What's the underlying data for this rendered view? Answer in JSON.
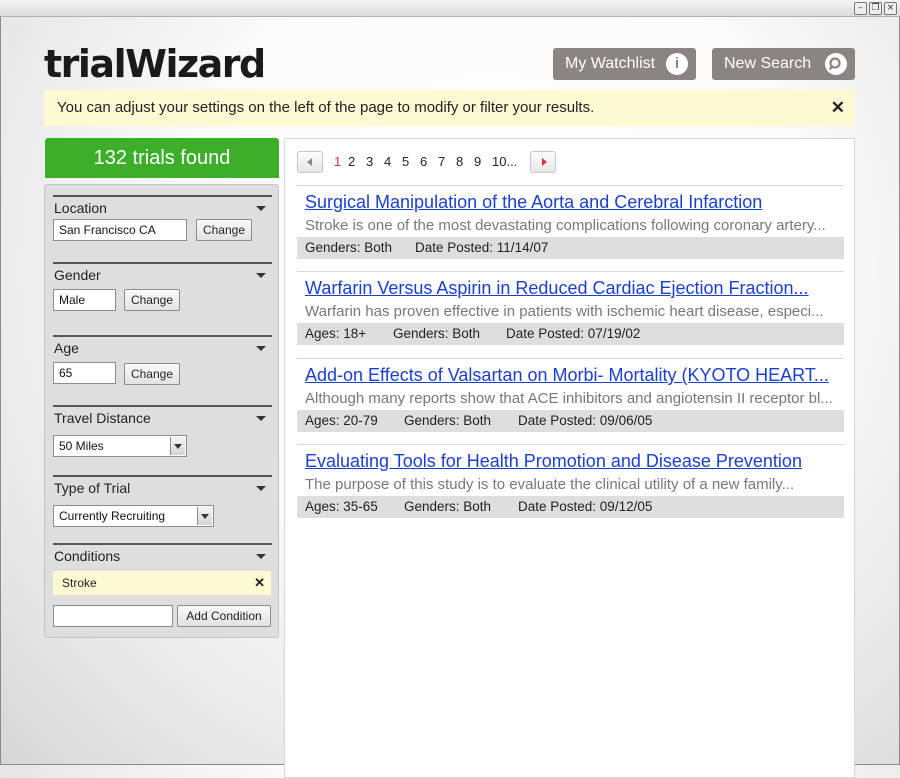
{
  "window": {
    "buttons": [
      "minimize",
      "restore",
      "close"
    ]
  },
  "app": {
    "logo_text": "trialWizard"
  },
  "header": {
    "watchlist_label": "My Watchlist",
    "watchlist_icon": "info-icon",
    "newsearch_label": "New Search",
    "newsearch_icon": "search-icon"
  },
  "notice": {
    "text": "You can adjust your settings on the left of the page to modify or filter your results.",
    "close": "✕"
  },
  "summary": {
    "found": "132 trials found"
  },
  "filters": {
    "location": {
      "label": "Location",
      "value": "San Francisco CA",
      "button": "Change"
    },
    "gender": {
      "label": "Gender",
      "value": "Male",
      "button": "Change"
    },
    "age": {
      "label": "Age",
      "value": "65",
      "button": "Change"
    },
    "distance": {
      "label": "Travel Distance",
      "value": "50 Miles"
    },
    "trial_type": {
      "label": "Type of Trial",
      "value": "Currently Recruiting"
    },
    "conditions": {
      "label": "Conditions",
      "items": [
        {
          "name": "Stroke",
          "remove": "✕"
        }
      ],
      "input_value": "",
      "add_button": "Add Condition"
    }
  },
  "pagination": {
    "current": "1",
    "pages": [
      "1",
      "2",
      "3",
      "4",
      "5",
      "6",
      "7",
      "8",
      "9",
      "10..."
    ]
  },
  "results": [
    {
      "title": "Surgical Manipulation of the Aorta and Cerebral Infarction",
      "desc": "Stroke is one of the most devastating complications following coronary artery...",
      "ages": "",
      "genders": "Genders: Both",
      "date": "Date Posted: 11/14/07"
    },
    {
      "title": "Warfarin Versus Aspirin in Reduced Cardiac Ejection Fraction...",
      "desc": "Warfarin has proven effective in patients with ischemic heart disease, especi...",
      "ages": "Ages: 18+",
      "genders": "Genders: Both",
      "date": "Date Posted: 07/19/02"
    },
    {
      "title": "Add-on Effects of Valsartan on Morbi- Mortality (KYOTO HEART...",
      "desc": "Although many reports show that ACE inhibitors and angiotensin II receptor bl...",
      "ages": "Ages: 20-79",
      "genders": "Genders: Both",
      "date": "Date Posted: 09/06/05"
    },
    {
      "title": "Evaluating Tools for Health Promotion and Disease Prevention",
      "desc": "The purpose of this study is to evaluate the clinical utility of a new family...",
      "ages": "Ages: 35-65",
      "genders": "Genders: Both",
      "date": "Date Posted: 09/12/05"
    }
  ],
  "colors": {
    "accent_green": "#3cae28",
    "notice_bg": "#fdf9d3",
    "link": "#1a3fd0",
    "header_button": "#8a8483"
  }
}
